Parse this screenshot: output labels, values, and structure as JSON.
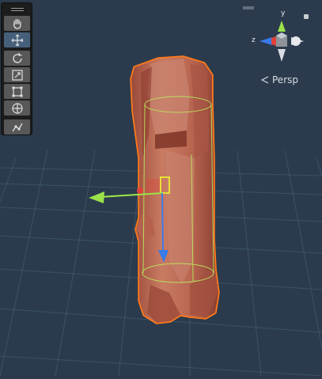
{
  "view": {
    "projection_label": "Persp",
    "axis_labels": {
      "y": "y",
      "z": "z"
    }
  },
  "toolbar": {
    "tools": [
      {
        "name": "hand-tool",
        "icon": "hand-icon",
        "active": false
      },
      {
        "name": "move-tool",
        "icon": "move-icon",
        "active": true
      },
      {
        "name": "rotate-tool",
        "icon": "rotate-icon",
        "active": false
      },
      {
        "name": "scale-tool",
        "icon": "scale-icon",
        "active": false
      },
      {
        "name": "rect-tool",
        "icon": "rect-icon",
        "active": false
      },
      {
        "name": "transform-tool",
        "icon": "transform-icon",
        "active": false
      },
      {
        "name": "custom-tool",
        "icon": "custom-icon",
        "active": false
      }
    ]
  },
  "colors": {
    "background": "#2b3b4d",
    "selection_outline": "#ff7a1a",
    "x_axis": "#e0413a",
    "y_axis": "#9be24a",
    "z_axis": "#3a7bea",
    "object": "#c06a55",
    "collider": "#b8f060"
  }
}
